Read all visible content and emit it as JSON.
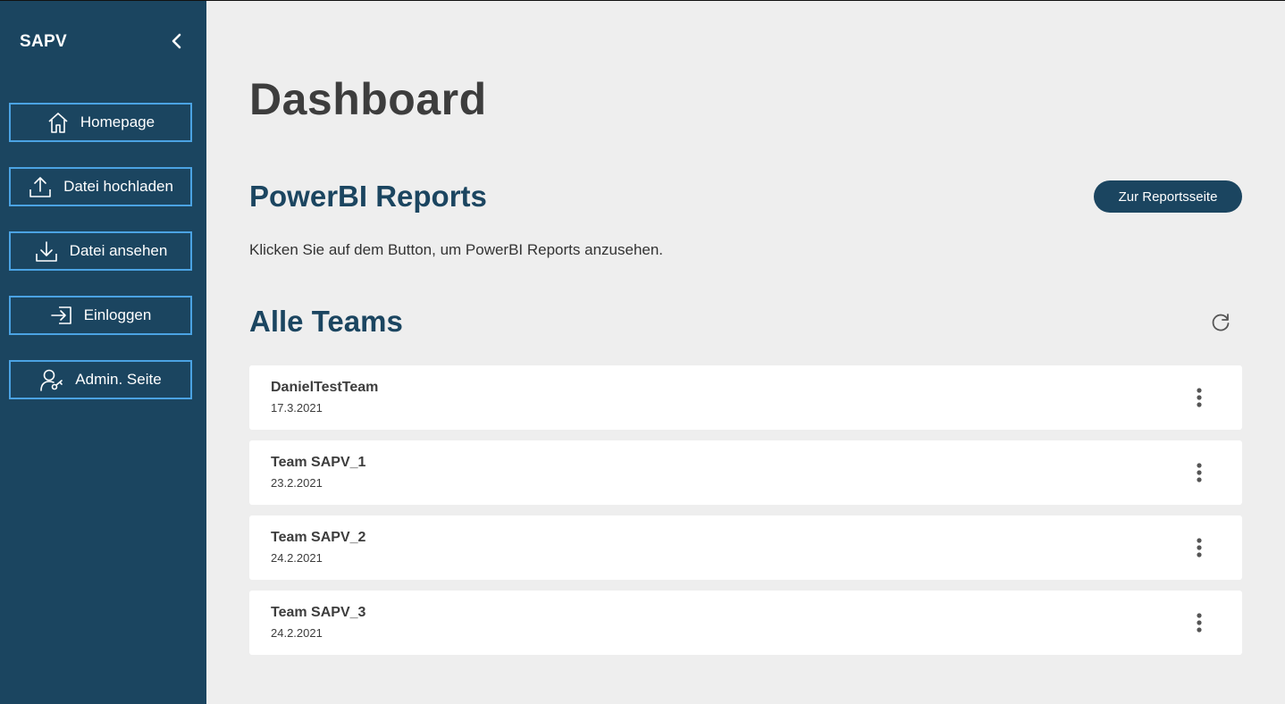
{
  "sidebar": {
    "brand": "SAPV",
    "collapse_icon": "chevron-left-icon",
    "items": [
      {
        "label": "Homepage",
        "icon": "home-icon"
      },
      {
        "label": "Datei hochladen",
        "icon": "upload-icon"
      },
      {
        "label": "Datei ansehen",
        "icon": "download-icon"
      },
      {
        "label": "Einloggen",
        "icon": "login-icon"
      },
      {
        "label": "Admin. Seite",
        "icon": "admin-user-icon"
      }
    ]
  },
  "main": {
    "title": "Dashboard",
    "powerbi": {
      "title": "PowerBI Reports",
      "button_label": "Zur Reportsseite",
      "description": "Klicken Sie auf dem Button, um PowerBI Reports anzusehen."
    },
    "teams": {
      "title": "Alle Teams",
      "refresh_icon": "refresh-icon",
      "items": [
        {
          "name": "DanielTestTeam",
          "date": "17.3.2021"
        },
        {
          "name": "Team SAPV_1",
          "date": "23.2.2021"
        },
        {
          "name": "Team SAPV_2",
          "date": "24.2.2021"
        },
        {
          "name": "Team SAPV_3",
          "date": "24.2.2021"
        }
      ]
    }
  },
  "colors": {
    "sidebar_bg": "#1b4560",
    "accent_border": "#4ba3e3",
    "page_bg": "#eeeeee",
    "heading": "#1b4560"
  }
}
